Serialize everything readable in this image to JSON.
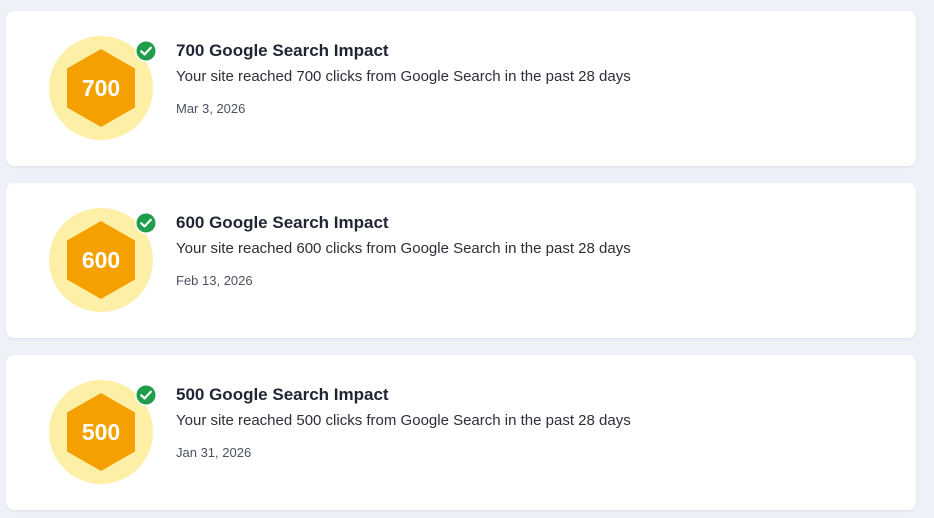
{
  "colors": {
    "page_background": "#eef1f7",
    "card_background": "#ffffff",
    "badge_circle": "#fdf0a6",
    "hexagon": "#f4a100",
    "check": "#1e9e4a"
  },
  "milestones": [
    {
      "badge_number": "700",
      "badge_icon": "hexagon-badge-icon",
      "status_icon": "check-circle-icon",
      "title": "700 Google Search Impact",
      "description": "Your site reached 700 clicks from Google Search in the past 28 days",
      "date": "Mar 3, 2026"
    },
    {
      "badge_number": "600",
      "badge_icon": "hexagon-badge-icon",
      "status_icon": "check-circle-icon",
      "title": "600 Google Search Impact",
      "description": "Your site reached 600 clicks from Google Search in the past 28 days",
      "date": "Feb 13, 2026"
    },
    {
      "badge_number": "500",
      "badge_icon": "hexagon-badge-icon",
      "status_icon": "check-circle-icon",
      "title": "500 Google Search Impact",
      "description": "Your site reached 500 clicks from Google Search in the past 28 days",
      "date": "Jan 31, 2026"
    }
  ]
}
